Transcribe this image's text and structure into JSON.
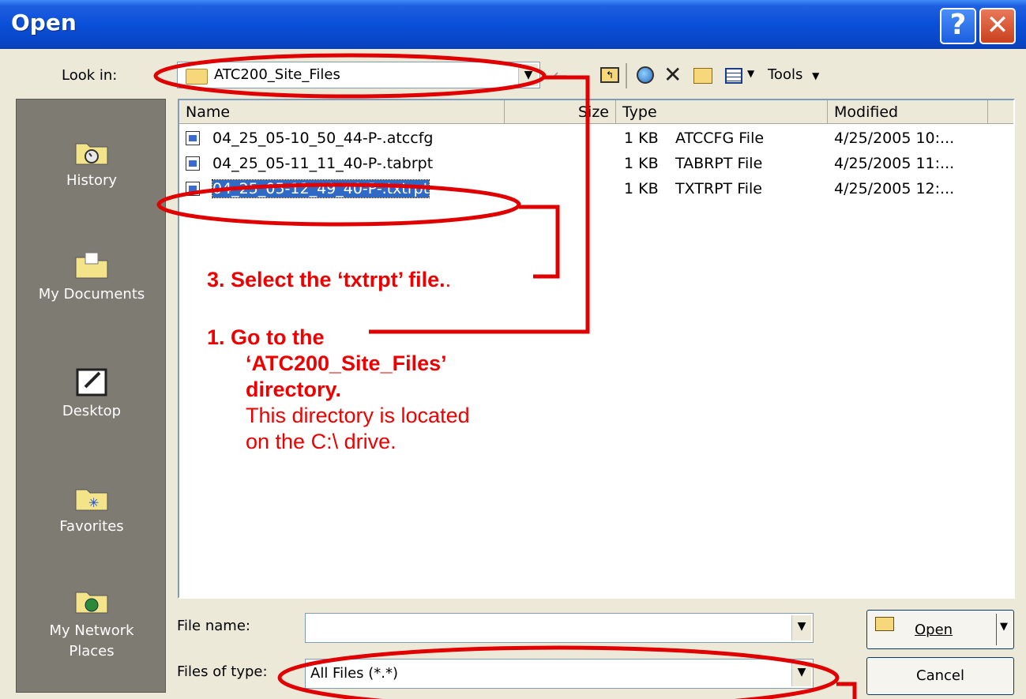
{
  "window": {
    "title": "Open"
  },
  "lookin": {
    "label": "Look in:",
    "value": "ATC200_Site_Files"
  },
  "toolbar": {
    "tools_label": "Tools"
  },
  "places": [
    "History",
    "My Documents",
    "Desktop",
    "Favorites",
    "My Network Places"
  ],
  "columns": [
    "Name",
    "Size",
    "Type",
    "Modified"
  ],
  "files": [
    {
      "name": "04_25_05-10_50_44-P-.atccfg",
      "size": "1 KB",
      "type": "ATCCFG File",
      "modified": "4/25/2005 10:..."
    },
    {
      "name": "04_25_05-11_11_40-P-.tabrpt",
      "size": "1 KB",
      "type": "TABRPT File",
      "modified": "4/25/2005 11:..."
    },
    {
      "name": "04_25_05-12_49_40-P-.txtrpt",
      "size": "1 KB",
      "type": "TXTRPT File",
      "modified": "4/25/2005 12:..."
    }
  ],
  "filename": {
    "label": "File name:",
    "value": ""
  },
  "filetype": {
    "label": "Files of type:",
    "value": "All Files (*.*)"
  },
  "buttons": {
    "open": "Open",
    "cancel": "Cancel"
  },
  "annotations": {
    "step3": "3. Select the ‘txtrpt’ file.",
    "step3_tail": ".",
    "step1_l1": "1. Go to the",
    "step1_l2": "‘ATC200_Site_Files’",
    "step1_l3": "directory.",
    "step1_l4": "This directory is located",
    "step1_l5": "on the C:\\ drive."
  },
  "colors": {
    "annotation": "#e00000",
    "titlebar": "#0a4fd8",
    "selection": "#316ac5"
  }
}
